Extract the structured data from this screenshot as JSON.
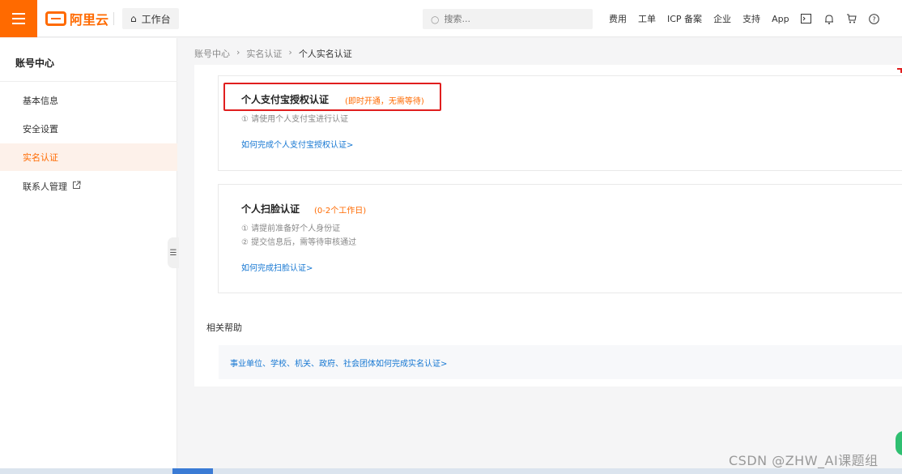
{
  "header": {
    "logo_text": "阿里云",
    "workbench_label": "工作台",
    "search_placeholder": "搜索...",
    "nav_items": [
      "费用",
      "工单",
      "ICP 备案",
      "企业",
      "支持",
      "App"
    ]
  },
  "sidebar": {
    "title": "账号中心",
    "items": [
      {
        "label": "基本信息"
      },
      {
        "label": "安全设置"
      },
      {
        "label": "实名认证",
        "active": true
      },
      {
        "label": "联系人管理"
      }
    ]
  },
  "breadcrumb": {
    "items": [
      "账号中心",
      "实名认证",
      "个人实名认证"
    ]
  },
  "cards": [
    {
      "title": "个人支付宝授权认证",
      "tag": "(即时开通，无需等待)",
      "lines": [
        "① 请使用个人支付宝进行认证"
      ],
      "link": "如何完成个人支付宝授权认证>"
    },
    {
      "title": "个人扫脸认证",
      "tag": "(0-2个工作日)",
      "lines": [
        "① 请提前准备好个人身份证",
        "② 提交信息后，需等待审核通过"
      ],
      "link": "如何完成扫脸认证>"
    }
  ],
  "help": {
    "title": "相关帮助",
    "link": "事业单位、学校、机关、政府、社会团体如何完成实名认证>"
  },
  "watermark": "CSDN @ZHW_AI课题组",
  "colors": {
    "brand": "#ff6a00",
    "link": "#1677d2",
    "highlight_border": "#e01e1e"
  }
}
